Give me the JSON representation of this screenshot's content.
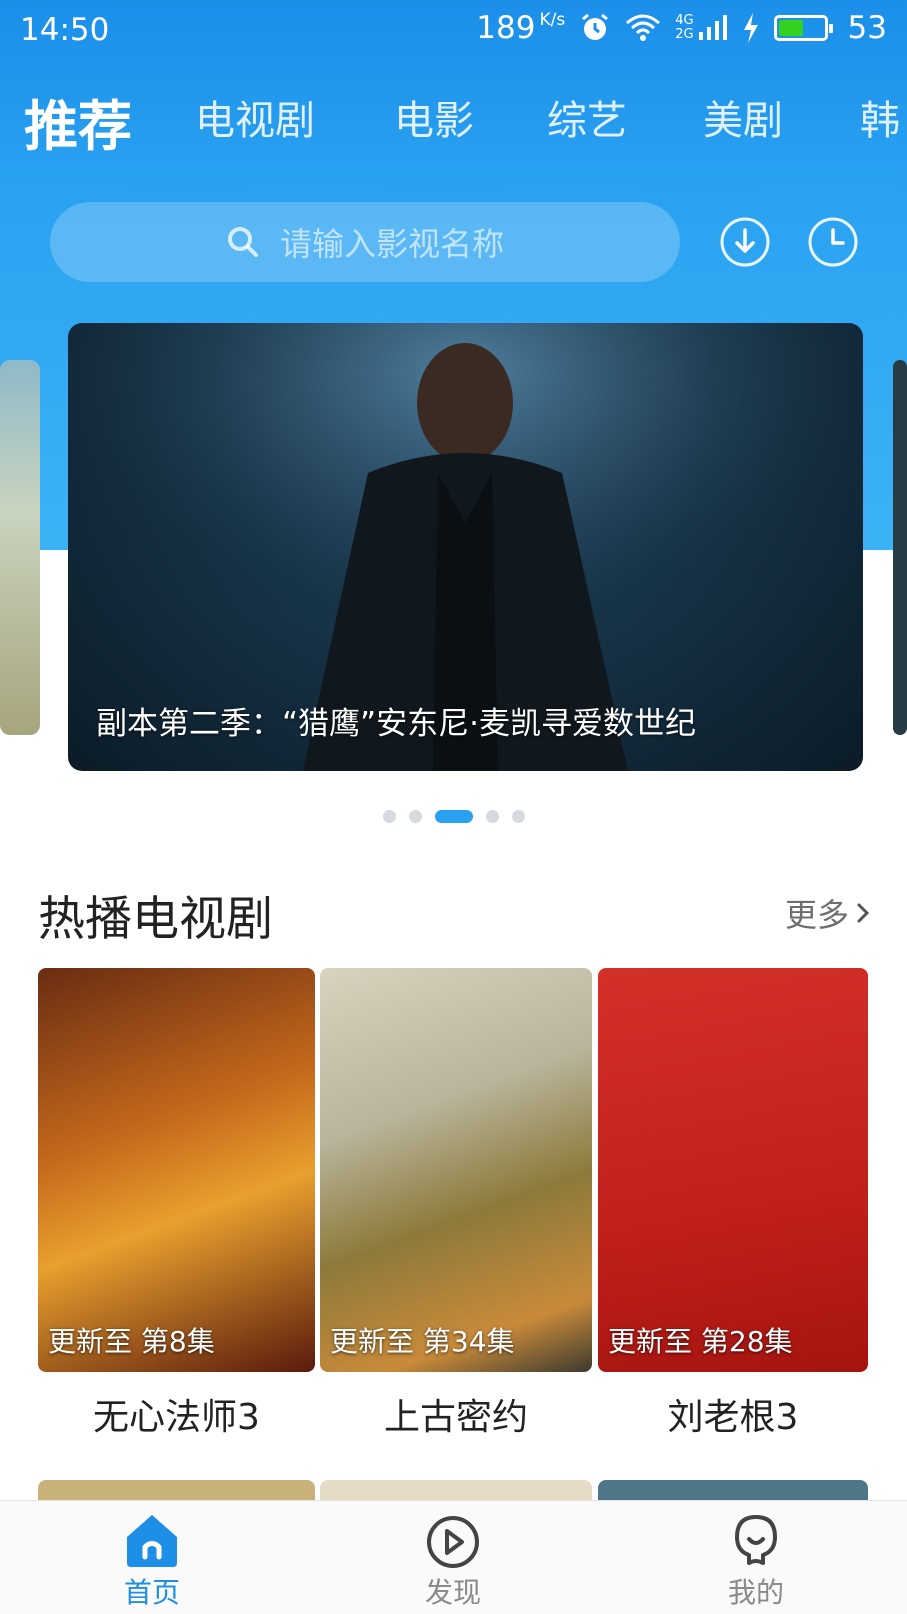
{
  "status_bar": {
    "time": "14:50",
    "net_speed": "189",
    "net_speed_unit": "K/s",
    "signal_4g": "4G",
    "signal_2g": "2G",
    "battery_level": "53"
  },
  "tabs": [
    {
      "label": "推荐",
      "active": true
    },
    {
      "label": "电视剧"
    },
    {
      "label": "电影"
    },
    {
      "label": "综艺"
    },
    {
      "label": "美剧"
    },
    {
      "label": "韩"
    }
  ],
  "search": {
    "placeholder": "请输入影视名称"
  },
  "banner": {
    "caption": "副本第二季：“猎鹰”安东尼·麦凯寻爱数世纪",
    "dots_total": 5,
    "dot_active_index": 2
  },
  "section": {
    "title": "热播电视剧",
    "more_label": "更多"
  },
  "shows": [
    {
      "title": "无心法师3",
      "update": "更新至 第8集"
    },
    {
      "title": "上古密约",
      "update": "更新至 第34集"
    },
    {
      "title": "刘老根3",
      "update": "更新至 第28集"
    }
  ],
  "bottom_nav": [
    {
      "label": "首页",
      "icon": "home-icon",
      "active": true
    },
    {
      "label": "发现",
      "icon": "play-circle-icon"
    },
    {
      "label": "我的",
      "icon": "profile-icon"
    }
  ],
  "colors": {
    "accent": "#1e8fe6",
    "header_blue": "#2aa2f1"
  }
}
